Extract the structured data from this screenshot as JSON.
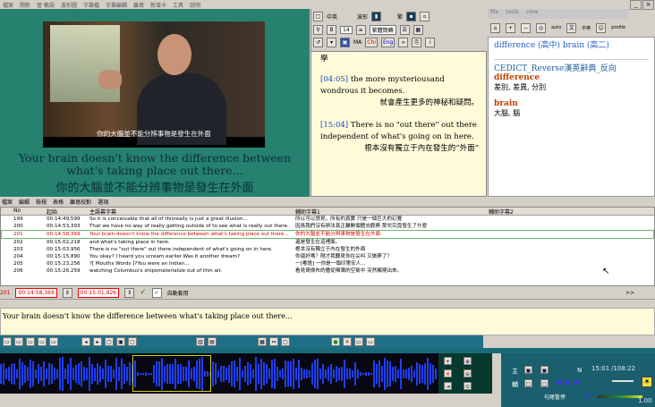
{
  "main_menu": [
    "檔案",
    "開新",
    "管‧載語",
    "波形圖",
    "字幕檔",
    "字幕編輯",
    "離寫",
    "新增卡",
    "工具",
    "說明"
  ],
  "video": {
    "burned_subtitle": "你的大腦並不能分辨事物是發生在外面",
    "subtitle_en": "Your brain doesn't know the difference between what's taking place out there...",
    "subtitle_zh": "你的大腦並不能分辨事物是發生在外面"
  },
  "mid_toolbar": {
    "row1": [
      "中英",
      "波形",
      "繁"
    ],
    "row2_select": "繁體簡轉",
    "row2_num": "14",
    "row3": [
      "MA",
      "Chi",
      "Eng"
    ]
  },
  "transcript": {
    "heading": "學",
    "entries": [
      {
        "time": "[04:05]",
        "en": "the more mysteriousand wondrous it becomes.",
        "zh": "就會產生更多的神秘和疑問。"
      },
      {
        "time": "[15:04]",
        "en": "There is no \"out there\" out there independent of what's going on in here.",
        "zh": "根本沒有獨立于內在發生的“外面”"
      }
    ]
  },
  "dictionary": {
    "menu": [
      "file",
      "tools",
      "view"
    ],
    "tools": [
      "auto",
      "中英",
      "profile"
    ],
    "top_line": "difference (高中)   brain (高二)",
    "source": "CEDICT_Reverse漢英辭典_反向",
    "entries": [
      {
        "word": "difference",
        "def": "差別, 差異, 分別"
      },
      {
        "word": "brain",
        "def": "大腦, 腦"
      }
    ]
  },
  "sub_menu": [
    "檔案",
    "編輯",
    "檢視",
    "表格",
    "離寫校對",
    "選項"
  ],
  "table": {
    "headers": [
      "No",
      "起始",
      "主語幕字幕",
      "輔助字幕1",
      "輔助字幕2"
    ],
    "rows": [
      {
        "no": "199",
        "time": "00:14:49,599",
        "main": "So it is conceivable that all of thisreally is just a great illusion...",
        "aux1": "所以可以想見，所有的真實 只是一個巨大的幻覺",
        "sel": false
      },
      {
        "no": "200",
        "time": "00:14:53,393",
        "main": "That we have no way of really getting outside of to see what is really out there.",
        "aux1": "因爲我們沒有辦法真正離開個體去觀察 那兒究竟發生了什麽",
        "sel": false
      },
      {
        "no": "201",
        "time": "00:14:58,369",
        "main": "Your brain doesn't know the difference between what's taking place out there...",
        "aux1": "你的大腦並不能分辨事物是發生在外面",
        "sel": true
      },
      {
        "no": "202",
        "time": "00:15:02,218",
        "main": "and what's taking place in here.",
        "aux1": "還是發生在這裡面。",
        "sel": false
      },
      {
        "no": "203",
        "time": "00:15:03,956",
        "main": "There is no \"out there\" out there independent of what's going on in here.",
        "aux1": "根本沒有獨立于內在發生的外面",
        "sel": false
      },
      {
        "no": "204",
        "time": "00:15:15,890",
        "main": "You okay? I heard you scream earlier.Was it another dream?",
        "aux1": "你還好嗎？剛才我聽見你在尖叫 又做夢了？",
        "sel": false
      },
      {
        "no": "205",
        "time": "00:15:23,256",
        "main": "?[ Mouths Words ]?You were an Indian...",
        "aux1": "一[嘟語] 一你是一個印第安人...",
        "sel": false
      },
      {
        "no": "206",
        "time": "00:15:26,259",
        "main": "watching Columbus's shipsmaterialize out of thin air.",
        "aux1": "看見哥倫布的艦從稀薄的空氣中 突然顯現出來。",
        "sel": false
      }
    ]
  },
  "edit_bar": {
    "row_no": "201",
    "start": "00:14:58,369",
    "end": "00:15:01,926",
    "auto_apply": "自動套用",
    "next": ">>"
  },
  "edit_text": "Your brain doesn't know the difference between what's taking place out there...",
  "player": {
    "main_label": "主",
    "aux_label": "輔",
    "n_label": "N",
    "time": "15:01",
    "total": "/108:22",
    "pause_label": "句尾暫停",
    "speed": "1.00"
  }
}
